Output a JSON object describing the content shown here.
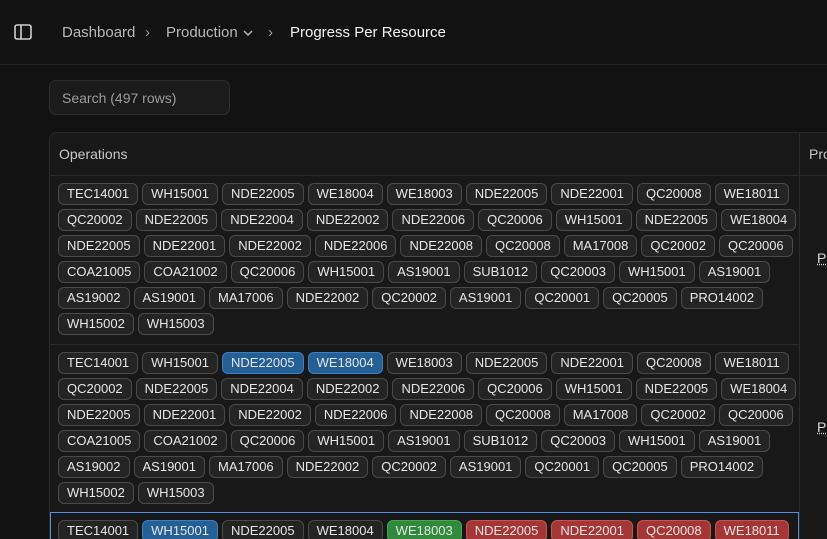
{
  "breadcrumb": {
    "items": [
      "Dashboard",
      "Production",
      "Progress Per Resource"
    ],
    "separator": "›"
  },
  "search": {
    "placeholder": "Search (497 rows)"
  },
  "table": {
    "columns": [
      "Operations",
      "Pro"
    ],
    "rows": [
      {
        "operations": [
          {
            "code": "TEC14001",
            "status": "default"
          },
          {
            "code": "WH15001",
            "status": "default"
          },
          {
            "code": "NDE22005",
            "status": "default"
          },
          {
            "code": "WE18004",
            "status": "default"
          },
          {
            "code": "WE18003",
            "status": "default"
          },
          {
            "code": "NDE22005",
            "status": "default"
          },
          {
            "code": "NDE22001",
            "status": "default"
          },
          {
            "code": "QC20008",
            "status": "default"
          },
          {
            "code": "WE18011",
            "status": "default"
          },
          {
            "code": "QC20002",
            "status": "default"
          },
          {
            "code": "NDE22005",
            "status": "default"
          },
          {
            "code": "NDE22004",
            "status": "default"
          },
          {
            "code": "NDE22002",
            "status": "default"
          },
          {
            "code": "NDE22006",
            "status": "default"
          },
          {
            "code": "QC20006",
            "status": "default"
          },
          {
            "code": "WH15001",
            "status": "default"
          },
          {
            "code": "NDE22005",
            "status": "default"
          },
          {
            "code": "WE18004",
            "status": "default"
          },
          {
            "code": "NDE22005",
            "status": "default"
          },
          {
            "code": "NDE22001",
            "status": "default"
          },
          {
            "code": "NDE22002",
            "status": "default"
          },
          {
            "code": "NDE22006",
            "status": "default"
          },
          {
            "code": "NDE22008",
            "status": "default"
          },
          {
            "code": "QC20008",
            "status": "default"
          },
          {
            "code": "MA17008",
            "status": "default"
          },
          {
            "code": "QC20002",
            "status": "default"
          },
          {
            "code": "QC20006",
            "status": "default"
          },
          {
            "code": "COA21005",
            "status": "default"
          },
          {
            "code": "COA21002",
            "status": "default"
          },
          {
            "code": "QC20006",
            "status": "default"
          },
          {
            "code": "WH15001",
            "status": "default"
          },
          {
            "code": "AS19001",
            "status": "default"
          },
          {
            "code": "SUB1012",
            "status": "default"
          },
          {
            "code": "QC20003",
            "status": "default"
          },
          {
            "code": "WH15001",
            "status": "default"
          },
          {
            "code": "AS19001",
            "status": "default"
          },
          {
            "code": "AS19002",
            "status": "default"
          },
          {
            "code": "AS19001",
            "status": "default"
          },
          {
            "code": "MA17006",
            "status": "default"
          },
          {
            "code": "NDE22002",
            "status": "default"
          },
          {
            "code": "QC20002",
            "status": "default"
          },
          {
            "code": "AS19001",
            "status": "default"
          },
          {
            "code": "QC20001",
            "status": "default"
          },
          {
            "code": "QC20005",
            "status": "default"
          },
          {
            "code": "PRO14002",
            "status": "default"
          },
          {
            "code": "WH15002",
            "status": "default"
          },
          {
            "code": "WH15003",
            "status": "default"
          }
        ],
        "progress_label": "P"
      },
      {
        "operations": [
          {
            "code": "TEC14001",
            "status": "default"
          },
          {
            "code": "WH15001",
            "status": "default"
          },
          {
            "code": "NDE22005",
            "status": "blue"
          },
          {
            "code": "WE18004",
            "status": "blue"
          },
          {
            "code": "WE18003",
            "status": "default"
          },
          {
            "code": "NDE22005",
            "status": "default"
          },
          {
            "code": "NDE22001",
            "status": "default"
          },
          {
            "code": "QC20008",
            "status": "default"
          },
          {
            "code": "WE18011",
            "status": "default"
          },
          {
            "code": "QC20002",
            "status": "default"
          },
          {
            "code": "NDE22005",
            "status": "default"
          },
          {
            "code": "NDE22004",
            "status": "default"
          },
          {
            "code": "NDE22002",
            "status": "default"
          },
          {
            "code": "NDE22006",
            "status": "default"
          },
          {
            "code": "QC20006",
            "status": "default"
          },
          {
            "code": "WH15001",
            "status": "default"
          },
          {
            "code": "NDE22005",
            "status": "default"
          },
          {
            "code": "WE18004",
            "status": "default"
          },
          {
            "code": "NDE22005",
            "status": "default"
          },
          {
            "code": "NDE22001",
            "status": "default"
          },
          {
            "code": "NDE22002",
            "status": "default"
          },
          {
            "code": "NDE22006",
            "status": "default"
          },
          {
            "code": "NDE22008",
            "status": "default"
          },
          {
            "code": "QC20008",
            "status": "default"
          },
          {
            "code": "MA17008",
            "status": "default"
          },
          {
            "code": "QC20002",
            "status": "default"
          },
          {
            "code": "QC20006",
            "status": "default"
          },
          {
            "code": "COA21005",
            "status": "default"
          },
          {
            "code": "COA21002",
            "status": "default"
          },
          {
            "code": "QC20006",
            "status": "default"
          },
          {
            "code": "WH15001",
            "status": "default"
          },
          {
            "code": "AS19001",
            "status": "default"
          },
          {
            "code": "SUB1012",
            "status": "default"
          },
          {
            "code": "QC20003",
            "status": "default"
          },
          {
            "code": "WH15001",
            "status": "default"
          },
          {
            "code": "AS19001",
            "status": "default"
          },
          {
            "code": "AS19002",
            "status": "default"
          },
          {
            "code": "AS19001",
            "status": "default"
          },
          {
            "code": "MA17006",
            "status": "default"
          },
          {
            "code": "NDE22002",
            "status": "default"
          },
          {
            "code": "QC20002",
            "status": "default"
          },
          {
            "code": "AS19001",
            "status": "default"
          },
          {
            "code": "QC20001",
            "status": "default"
          },
          {
            "code": "QC20005",
            "status": "default"
          },
          {
            "code": "PRO14002",
            "status": "default"
          },
          {
            "code": "WH15002",
            "status": "default"
          },
          {
            "code": "WH15003",
            "status": "default"
          }
        ],
        "progress_label": "P"
      },
      {
        "operations": [
          {
            "code": "TEC14001",
            "status": "default"
          },
          {
            "code": "WH15001",
            "status": "blue"
          },
          {
            "code": "NDE22005",
            "status": "default"
          },
          {
            "code": "WE18004",
            "status": "default"
          },
          {
            "code": "WE18003",
            "status": "green"
          },
          {
            "code": "NDE22005",
            "status": "red"
          },
          {
            "code": "NDE22001",
            "status": "red"
          },
          {
            "code": "QC20008",
            "status": "red"
          },
          {
            "code": "WE18011",
            "status": "red"
          }
        ],
        "progress_label": "",
        "selected": true
      }
    ]
  },
  "colors": {
    "background": "#121212",
    "blue": "#245f96",
    "green": "#2f8a3b",
    "red": "#a63636",
    "selection": "#4f8fe6"
  },
  "icons": {
    "sidebar_toggle": "sidebar-toggle-icon",
    "chevron": "chevron-down-icon"
  }
}
